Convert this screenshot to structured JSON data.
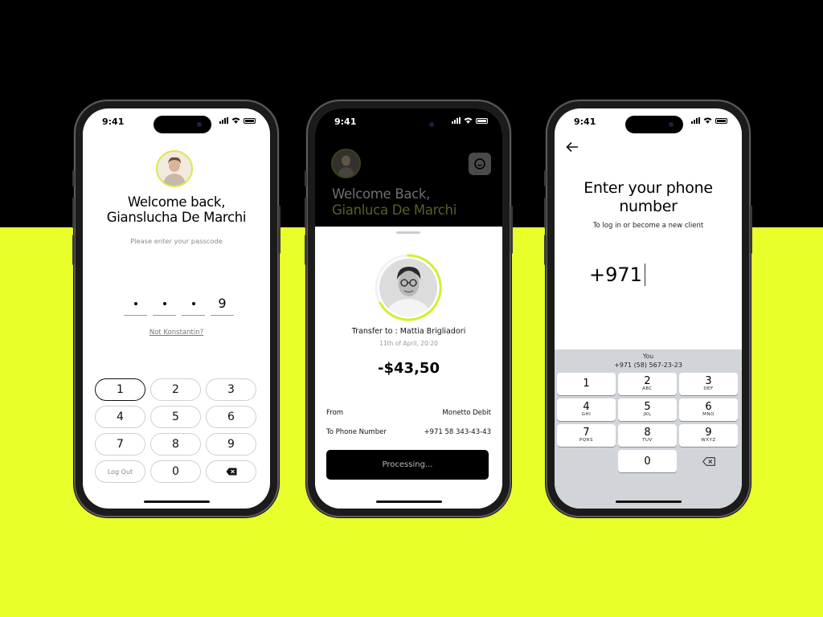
{
  "status_time": "9:41",
  "screen1": {
    "title_line1": "Welcome back,",
    "title_line2": "Gianslucha De Marchi",
    "subtitle": "Please enter your passcode",
    "pin_last_digit": "9",
    "not_user_link": "Not Konstantin?",
    "keys": [
      "1",
      "2",
      "3",
      "4",
      "5",
      "6",
      "7",
      "8",
      "9"
    ],
    "logout_label": "Log Out",
    "zero_key": "0",
    "backspace_icon": "backspace-icon"
  },
  "screen2": {
    "title_line1": "Welcome Back,",
    "title_line2": "Gianluca De Marchi",
    "transfer_to": "Transfer to : Mattia Brigliadori",
    "date": "11th of April, 20:20",
    "amount": "-$43,50",
    "from_label": "From",
    "from_value": "Monetto Debit",
    "to_label": "To Phone Number",
    "to_value": "+971 58 343-43-43",
    "processing_label": "Processing...",
    "chat_icon": "chat-icon",
    "accent": "#d6ee2f"
  },
  "screen3": {
    "back_icon": "arrow-left-icon",
    "title_line1": "Enter your phone",
    "title_line2": "number",
    "subtitle": "To log in or become a new client",
    "phone_value": "+971",
    "suggestion_label": "You",
    "suggestion_number": "+971 (58) 567-23-23",
    "keys": [
      {
        "n": "1",
        "l": ""
      },
      {
        "n": "2",
        "l": "ABC"
      },
      {
        "n": "3",
        "l": "DEF"
      },
      {
        "n": "4",
        "l": "GHI"
      },
      {
        "n": "5",
        "l": "JKL"
      },
      {
        "n": "6",
        "l": "MNO"
      },
      {
        "n": "7",
        "l": "PQRS"
      },
      {
        "n": "8",
        "l": "TUV"
      },
      {
        "n": "9",
        "l": "WXYZ"
      }
    ],
    "zero_key": "0"
  }
}
